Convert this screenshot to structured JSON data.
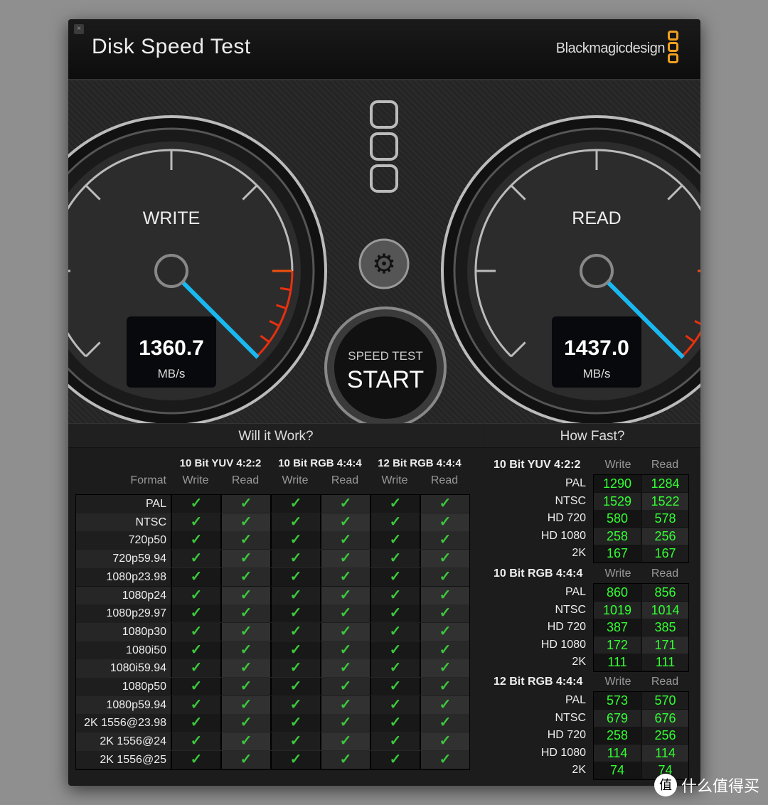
{
  "window": {
    "title": "Disk Speed Test",
    "brand": "Blackmagicdesign",
    "close_icon": "close-icon"
  },
  "gauges": {
    "write": {
      "label": "WRITE",
      "value": "1360.7",
      "unit": "MB/s",
      "needle_fraction": 1.0
    },
    "read": {
      "label": "READ",
      "value": "1437.0",
      "unit": "MB/s",
      "needle_fraction": 1.0
    },
    "needle_color": "#1ab8f0",
    "redzone_color": "#e83010"
  },
  "start": {
    "top": "SPEED TEST",
    "main": "START"
  },
  "will_it_work": {
    "title": "Will it Work?",
    "format_label": "Format",
    "groups": [
      "10 Bit YUV 4:2:2",
      "10 Bit RGB 4:4:4",
      "12 Bit RGB 4:4:4"
    ],
    "subs": [
      "Write",
      "Read",
      "Write",
      "Read",
      "Write",
      "Read"
    ],
    "rows": [
      "PAL",
      "NTSC",
      "720p50",
      "720p59.94",
      "1080p23.98",
      "1080p24",
      "1080p29.97",
      "1080p30",
      "1080i50",
      "1080i59.94",
      "1080p50",
      "1080p59.94",
      "2K 1556@23.98",
      "2K 1556@24",
      "2K 1556@25"
    ],
    "check": "✓"
  },
  "how_fast": {
    "title": "How Fast?",
    "write_label": "Write",
    "read_label": "Read",
    "sections": [
      {
        "name": "10 Bit YUV 4:2:2",
        "rows": [
          [
            "PAL",
            "1290",
            "1284"
          ],
          [
            "NTSC",
            "1529",
            "1522"
          ],
          [
            "HD 720",
            "580",
            "578"
          ],
          [
            "HD 1080",
            "258",
            "256"
          ],
          [
            "2K",
            "167",
            "167"
          ]
        ]
      },
      {
        "name": "10 Bit RGB 4:4:4",
        "rows": [
          [
            "PAL",
            "860",
            "856"
          ],
          [
            "NTSC",
            "1019",
            "1014"
          ],
          [
            "HD 720",
            "387",
            "385"
          ],
          [
            "HD 1080",
            "172",
            "171"
          ],
          [
            "2K",
            "111",
            "111"
          ]
        ]
      },
      {
        "name": "12 Bit RGB 4:4:4",
        "rows": [
          [
            "PAL",
            "573",
            "570"
          ],
          [
            "NTSC",
            "679",
            "676"
          ],
          [
            "HD 720",
            "258",
            "256"
          ],
          [
            "HD 1080",
            "114",
            "114"
          ],
          [
            "2K",
            "74",
            "74"
          ]
        ]
      }
    ]
  },
  "watermark": {
    "icon": "值",
    "text": "什么值得买"
  }
}
